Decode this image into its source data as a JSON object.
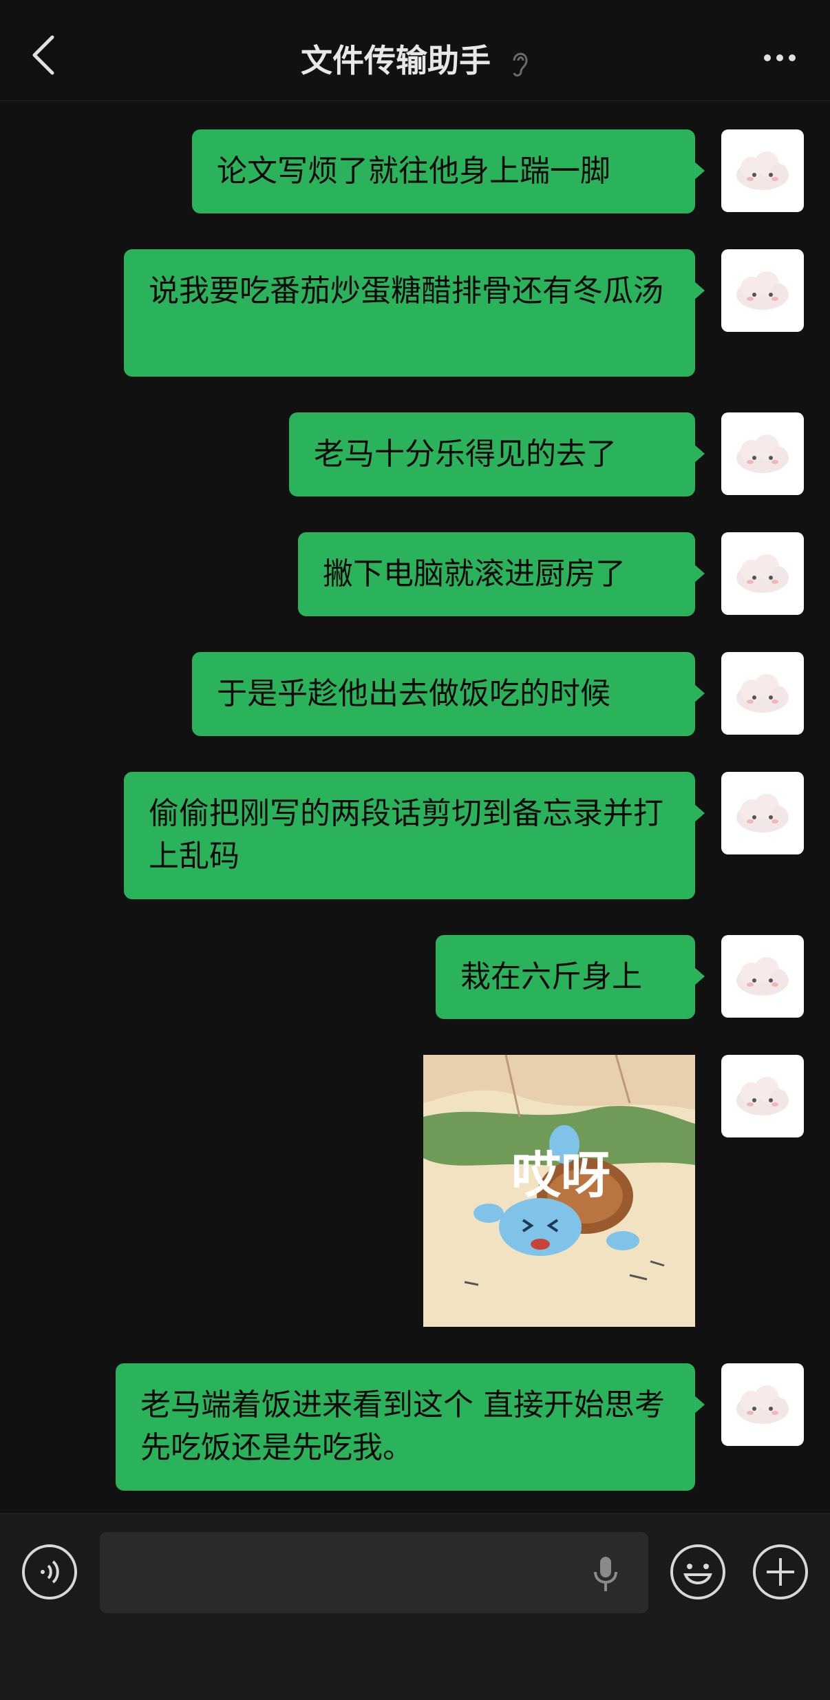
{
  "header": {
    "title": "文件传输助手"
  },
  "messages": [
    {
      "text": "论文写烦了就往他身上踹一脚"
    },
    {
      "text": "说我要吃番茄炒蛋糖醋排骨还有冬瓜汤"
    },
    {
      "text": "老马十分乐得见的去了"
    },
    {
      "text": "撇下电脑就滚进厨房了"
    },
    {
      "text": "于是乎趁他出去做饭吃的时候"
    },
    {
      "text": "偷偷把刚写的两段话剪切到备忘录并打上乱码"
    },
    {
      "text": "栽在六斤身上"
    },
    {
      "sticker_text": "哎呀"
    },
    {
      "text": "老马端着饭进来看到这个 直接开始思考先吃饭还是先吃我。"
    }
  ],
  "input": {
    "placeholder": ""
  },
  "colors": {
    "bubble": "#2bb35c",
    "background": "#111111",
    "bar": "#1a1a1a"
  },
  "icons": [
    "back-arrow-icon",
    "ear-icon",
    "more-icon",
    "voice-icon",
    "mic-icon",
    "emoji-icon",
    "plus-icon"
  ]
}
